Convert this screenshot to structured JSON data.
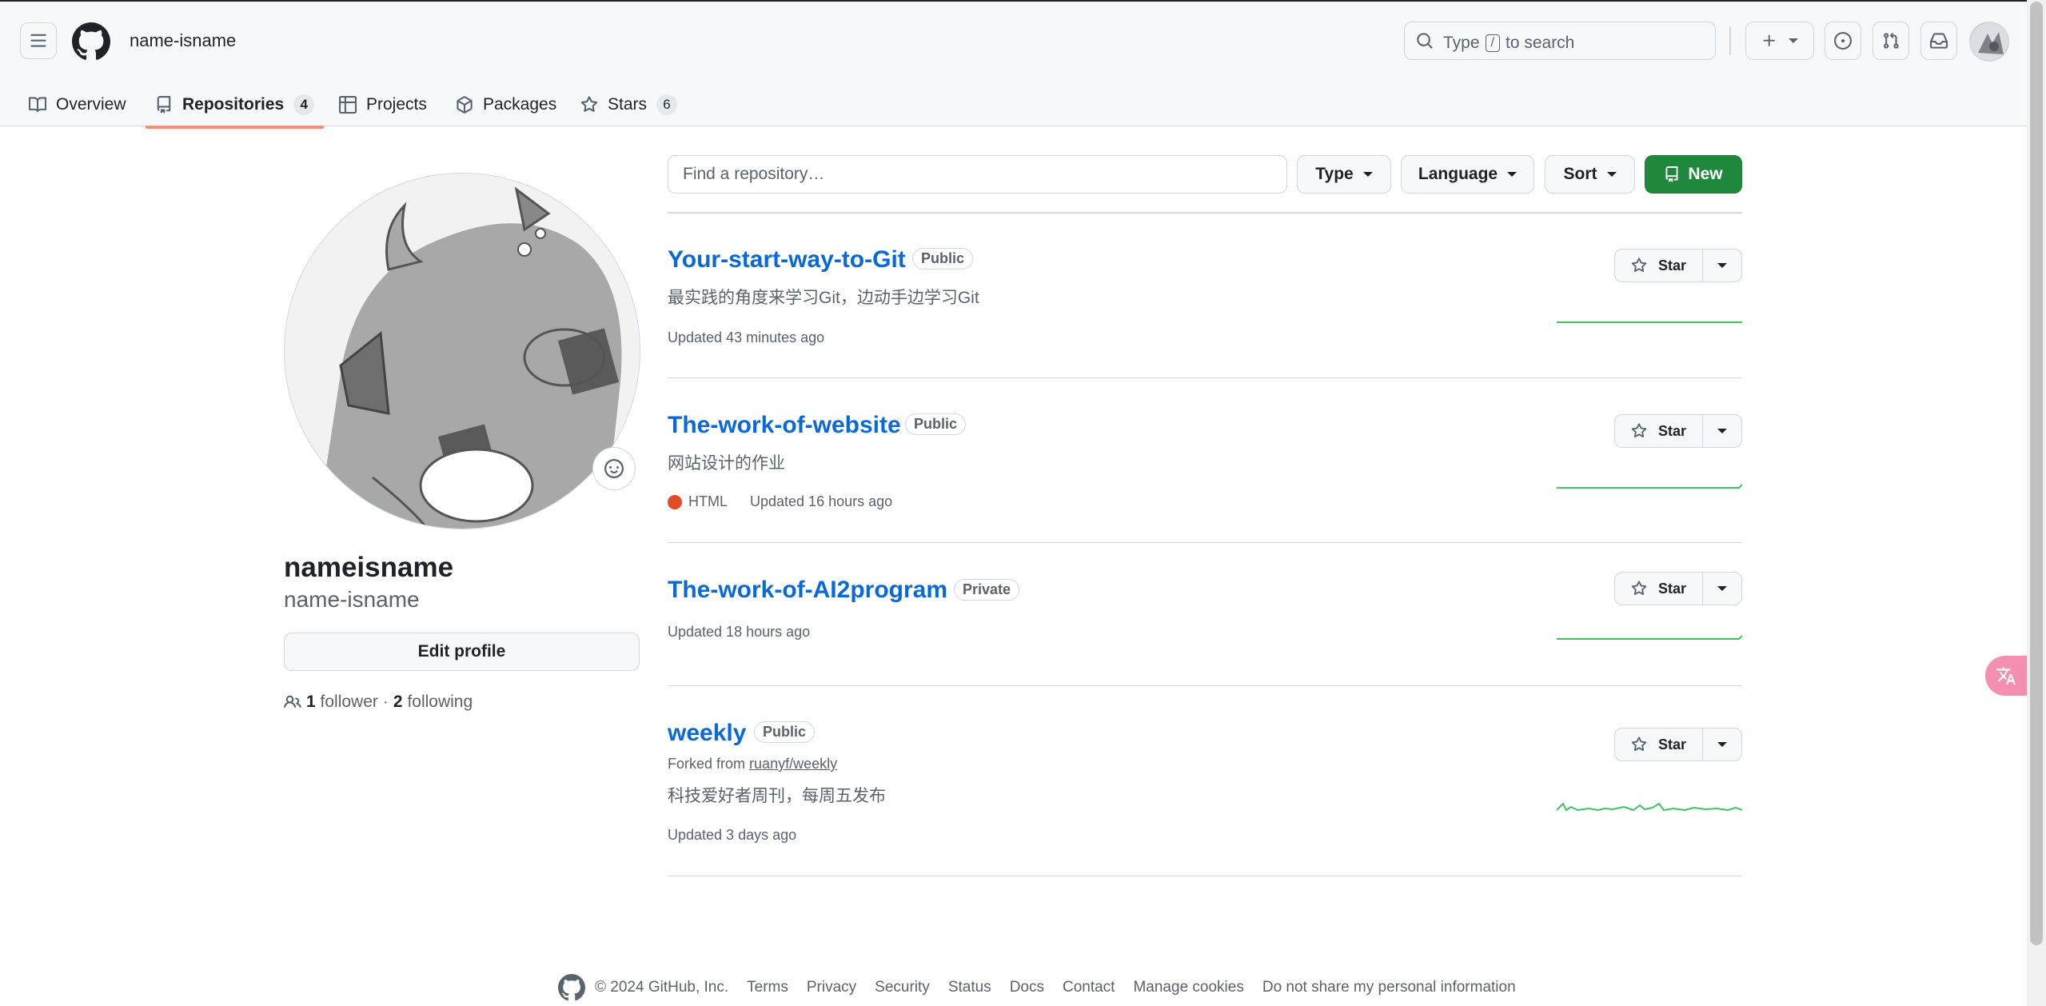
{
  "header": {
    "username": "name-isname",
    "search_prefix": "Type",
    "search_key": "/",
    "search_suffix": "to search"
  },
  "tabs": [
    {
      "label": "Overview",
      "icon": "book-icon"
    },
    {
      "label": "Repositories",
      "count": "4",
      "icon": "repo-icon",
      "active": true
    },
    {
      "label": "Projects",
      "icon": "table-icon"
    },
    {
      "label": "Packages",
      "icon": "package-icon"
    },
    {
      "label": "Stars",
      "count": "6",
      "icon": "star-icon"
    }
  ],
  "profile": {
    "display_name": "nameisname",
    "login": "name-isname",
    "edit_label": "Edit profile",
    "followers_count": "1",
    "followers_label": "follower",
    "separator": "·",
    "following_count": "2",
    "following_label": "following"
  },
  "filters": {
    "find_placeholder": "Find a repository…",
    "type_label": "Type",
    "language_label": "Language",
    "sort_label": "Sort",
    "new_label": "New"
  },
  "repos": [
    {
      "name": "Your-start-way-to-Git",
      "visibility": "Public",
      "description": "最实践的角度来学习Git，边动手边学习Git",
      "updated": "Updated 43 minutes ago",
      "star_label": "Star"
    },
    {
      "name": "The-work-of-website",
      "visibility": "Public",
      "description": "网站设计的作业",
      "language": "HTML",
      "language_color": "#e34c26",
      "updated": "Updated 16 hours ago",
      "star_label": "Star"
    },
    {
      "name": "The-work-of-AI2program",
      "visibility": "Private",
      "updated": "Updated 18 hours ago",
      "star_label": "Star"
    },
    {
      "name": "weekly",
      "visibility": "Public",
      "forked_prefix": "Forked from",
      "forked_from": "ruanyf/weekly",
      "description": "科技爱好者周刊，每周五发布",
      "updated": "Updated 3 days ago",
      "star_label": "Star"
    }
  ],
  "footer": {
    "copyright": "© 2024 GitHub, Inc.",
    "links": [
      "Terms",
      "Privacy",
      "Security",
      "Status",
      "Docs",
      "Contact",
      "Manage cookies",
      "Do not share my personal information"
    ]
  },
  "colors": {
    "link": "#0969da",
    "new_button": "#1f883d",
    "active_tab_underline": "#fd8c73",
    "sparkline": "#40c463"
  }
}
